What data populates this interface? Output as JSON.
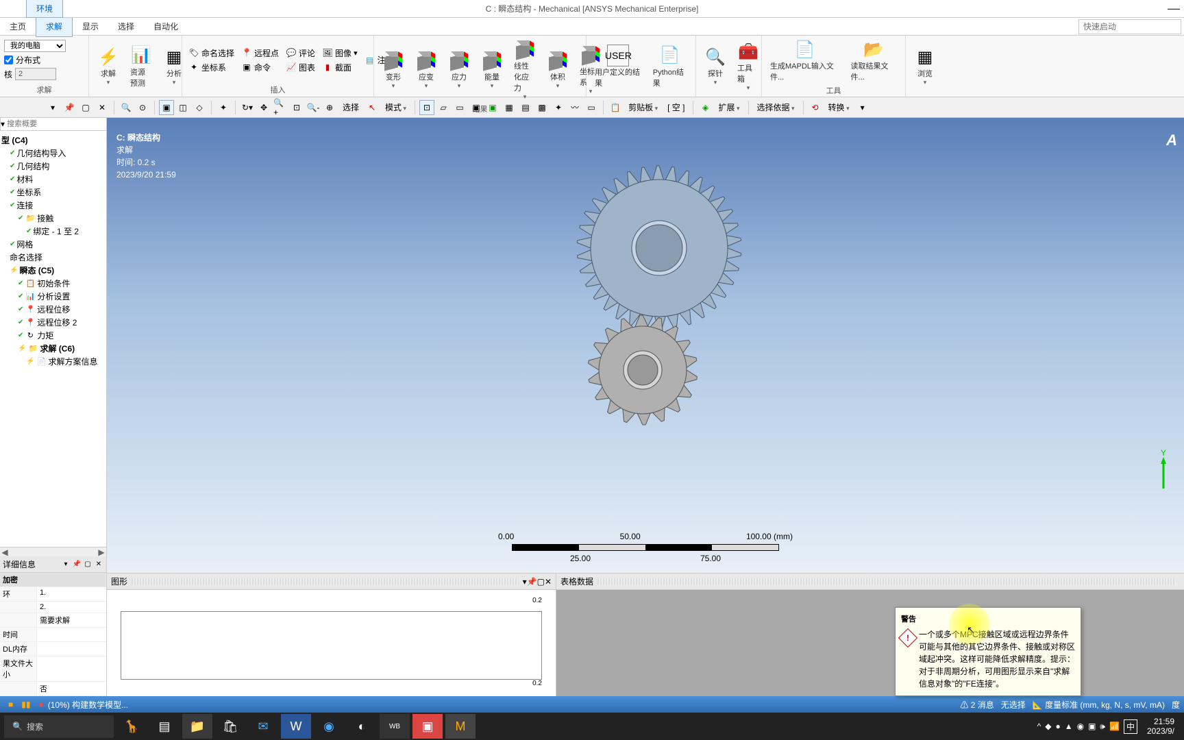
{
  "title_tab": "环境",
  "window_title": "C : 瞬态结构 - Mechanical [ANSYS Mechanical Enterprise]",
  "menu": [
    "主页",
    "求解",
    "显示",
    "选择",
    "自动化"
  ],
  "menu_active_index": 1,
  "quick_launch_placeholder": "快速启动",
  "ribbon": {
    "g1": {
      "label": "求解",
      "computer_sel": "我的电脑",
      "distributed": "分布式",
      "cores_label": "核",
      "cores_value": "2",
      "solve": "求解",
      "resource": "资源预测"
    },
    "g2_analysis": "分析",
    "g3": {
      "label": "插入",
      "named": "命名选择",
      "remote": "远程点",
      "comment": "评论",
      "image": "图像",
      "cs": "坐标系",
      "cmd": "命令",
      "chart": "图表",
      "section": "截面",
      "annotation": "注释"
    },
    "g4": {
      "label": "结果",
      "items": [
        "变形",
        "应变",
        "应力",
        "能量",
        "线性化应力",
        "体积",
        "坐标系"
      ]
    },
    "g5_user": "用户定义的结果",
    "g5_python": "Python结果",
    "g6_probe": "探针",
    "g6_toolbox": "工具箱",
    "g7": {
      "label": "工具",
      "items": [
        "生成MAPDL输入文件...",
        "读取结果文件..."
      ]
    },
    "g8_browse": "浏览"
  },
  "toolbar": {
    "select": "选择",
    "mode": "模式",
    "clipboard": "剪贴板",
    "empty": "[ 空 ]",
    "extend": "扩展",
    "select_by": "选择依据",
    "convert": "转换"
  },
  "outline": {
    "search_placeholder": "搜索概要",
    "nodes": [
      {
        "lvl": 1,
        "label": "型 (C4)",
        "bold": true
      },
      {
        "lvl": 2,
        "label": "几何结构导入",
        "chk": true
      },
      {
        "lvl": 2,
        "label": "几何结构",
        "chk": true
      },
      {
        "lvl": 2,
        "label": "材料",
        "chk": true
      },
      {
        "lvl": 2,
        "label": "坐标系",
        "chk": true
      },
      {
        "lvl": 2,
        "label": "连接",
        "chk": true
      },
      {
        "lvl": 3,
        "label": "接触",
        "chk": true,
        "icon": "📁"
      },
      {
        "lvl": 4,
        "label": "绑定 - 1 至 2",
        "chk": true
      },
      {
        "lvl": 2,
        "label": "网格",
        "chk": true
      },
      {
        "lvl": 2,
        "label": "命名选择"
      },
      {
        "lvl": 2,
        "label": "瞬态 (C5)",
        "bold": true,
        "bolt": true
      },
      {
        "lvl": 3,
        "label": "初始条件",
        "chk": true,
        "icon": "📋"
      },
      {
        "lvl": 3,
        "label": "分析设置",
        "chk": true,
        "icon": "📊"
      },
      {
        "lvl": 3,
        "label": "远程位移",
        "chk": true,
        "icon": "📍"
      },
      {
        "lvl": 3,
        "label": "远程位移 2",
        "chk": true,
        "icon": "📍"
      },
      {
        "lvl": 3,
        "label": "力矩",
        "chk": true,
        "icon": "↻"
      },
      {
        "lvl": 3,
        "label": "求解 (C6)",
        "bold": true,
        "bolt": true,
        "icon": "📁"
      },
      {
        "lvl": 4,
        "label": "求解方案信息",
        "bolt": true,
        "icon": "📄"
      }
    ]
  },
  "details": {
    "header": "详细信息",
    "rows": [
      {
        "k": "加密",
        "v": "",
        "hdr": true
      },
      {
        "k": " 环",
        "v": "1."
      },
      {
        "k": "",
        "v": "2."
      },
      {
        "k": "",
        "v": "需要求解"
      },
      {
        "k": "时间",
        "v": ""
      },
      {
        "k": "DL内存",
        "v": ""
      },
      {
        "k": "果文件大小",
        "v": ""
      },
      {
        "k": "",
        "v": "否"
      }
    ]
  },
  "viewport": {
    "title": "C: 瞬态结构",
    "sub1": "求解",
    "time": "时间: 0.2 s",
    "date": "2023/9/20 21:59",
    "logo": "A",
    "triad_y": "Y",
    "scale": {
      "l0": "0.00",
      "l50": "50.00",
      "l100": "100.00 (mm)",
      "b25": "25.00",
      "b75": "75.00"
    }
  },
  "panels": {
    "graph": "图形",
    "table": "表格数据",
    "g_top": "0.2",
    "g_bot": "0.2"
  },
  "warning": {
    "title": "警告",
    "body": "一个或多个MPC接触区域或远程边界条件可能与其他的其它边界条件、接触或对称区域起冲突。这样可能降低求解精度。提示：对于非周期分析，可用图形显示来自\"求解信息对象\"的\"FE连接\"。"
  },
  "status": {
    "progress": "(10%) 构建数学模型...",
    "msg": "2 消息",
    "nosel": "无选择",
    "units": "度量标准 (mm, kg, N, s, mV, mA)",
    "deg": "度"
  },
  "taskbar": {
    "search": "搜索",
    "ime": "中",
    "time": "21:59",
    "date": "2023/9/"
  }
}
